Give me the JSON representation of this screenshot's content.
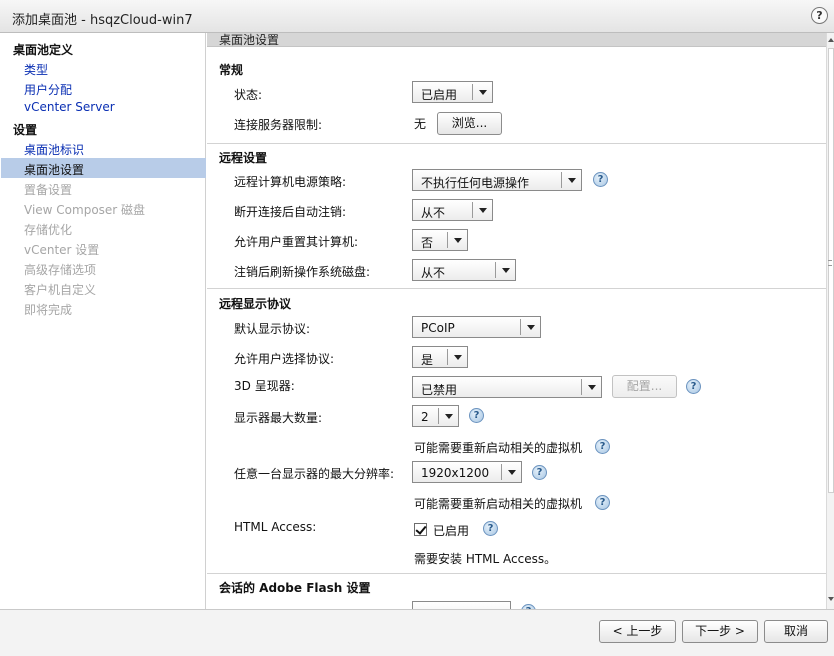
{
  "window": {
    "title": "添加桌面池 - hsqzCloud-win7",
    "help": "?"
  },
  "sidebar": {
    "section1": "桌面池定义",
    "section1_items": [
      "类型",
      "用户分配",
      "vCenter Server"
    ],
    "section2": "设置",
    "section2_items": [
      "桌面池标识"
    ],
    "selected": "桌面池设置",
    "disabled_items": [
      "置备设置",
      "View Composer 磁盘",
      "存储优化",
      "vCenter 设置",
      "高级存储选项",
      "客户机自定义",
      "即将完成"
    ]
  },
  "main": {
    "header": "桌面池设置",
    "general": {
      "title": "常规",
      "state_label": "状态:",
      "state_value": "已启用",
      "conn_label": "连接服务器限制:",
      "conn_value": "无",
      "browse": "浏览..."
    },
    "remote": {
      "title": "远程设置",
      "power_label": "远程计算机电源策略:",
      "power_value": "不执行任何电源操作",
      "logoff_label": "断开连接后自动注销:",
      "logoff_value": "从不",
      "reset_label": "允许用户重置其计算机:",
      "reset_value": "否",
      "refresh_label": "注销后刷新操作系统磁盘:",
      "refresh_value": "从不"
    },
    "display": {
      "title": "远程显示协议",
      "default_label": "默认显示协议:",
      "default_value": "PCoIP",
      "choose_label": "允许用户选择协议:",
      "choose_value": "是",
      "renderer_label": "3D 呈现器:",
      "renderer_value": "已禁用",
      "config": "配置...",
      "max_label": "显示器最大数量:",
      "max_value": "2",
      "restart_note1": "可能需要重新启动相关的虚拟机",
      "res_label": "任意一台显示器的最大分辨率:",
      "res_value": "1920x1200",
      "restart_note2": "可能需要重新启动相关的虚拟机",
      "html_label": "HTML Access:",
      "html_value": "已启用",
      "html_note": "需要安装 HTML Access。"
    },
    "flash": {
      "title": "会话的 Adobe Flash 设置"
    }
  },
  "footer": {
    "prev": "< 上一步",
    "next": "下一步 >",
    "cancel": "取消"
  }
}
